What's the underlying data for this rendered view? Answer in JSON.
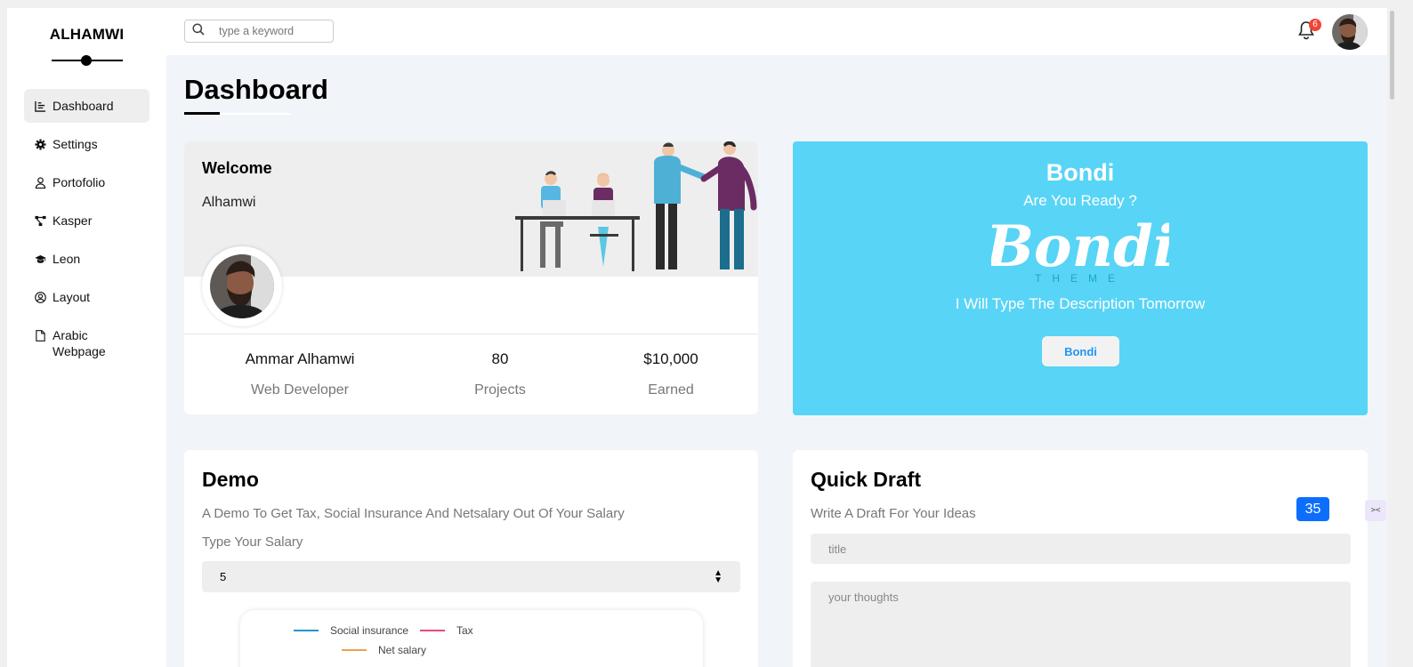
{
  "sidebar": {
    "brand": "ALHAMWI",
    "items": [
      {
        "label": "Dashboard",
        "icon": "chart-line-icon"
      },
      {
        "label": "Settings",
        "icon": "gear-icon"
      },
      {
        "label": "Portofolio",
        "icon": "user-icon"
      },
      {
        "label": "Kasper",
        "icon": "diagram-icon"
      },
      {
        "label": "Leon",
        "icon": "graduation-cap-icon"
      },
      {
        "label": "Layout",
        "icon": "user-circle-icon"
      },
      {
        "label": "Arabic Webpage",
        "icon": "file-icon"
      }
    ]
  },
  "header": {
    "search_placeholder": "type a keyword",
    "notifications": "6"
  },
  "page_title": "Dashboard",
  "welcome": {
    "title": "Welcome",
    "name": "Alhamwi",
    "stats": [
      {
        "value": "Ammar Alhamwi",
        "label": "Web Developer"
      },
      {
        "value": "80",
        "label": "Projects"
      },
      {
        "value": "$10,000",
        "label": "Earned"
      }
    ]
  },
  "bondi": {
    "title": "Bondi",
    "subtitle": "Are You Ready ?",
    "logo_text": "Bondi",
    "logo_sub": "THEME",
    "description": "I Will Type The Description Tomorrow",
    "button": "Bondi"
  },
  "demo": {
    "title": "Demo",
    "description": "A Demo To Get Tax, Social Insurance And Netsalary Out Of Your Salary",
    "label": "Type Your Salary",
    "salary_value": "5",
    "legend": [
      "Social insurance",
      "Tax",
      "Net salary"
    ]
  },
  "draft": {
    "title": "Quick Draft",
    "description": "Write A Draft For Your Ideas",
    "counter": "35",
    "title_placeholder": "title",
    "text_placeholder": "your thoughts"
  },
  "colors": {
    "accent": "#58d4f6",
    "badge": "#f44336",
    "counter": "#0d6efd",
    "legend": [
      "#2196c9",
      "#e8487a",
      "#f0a04b"
    ]
  }
}
